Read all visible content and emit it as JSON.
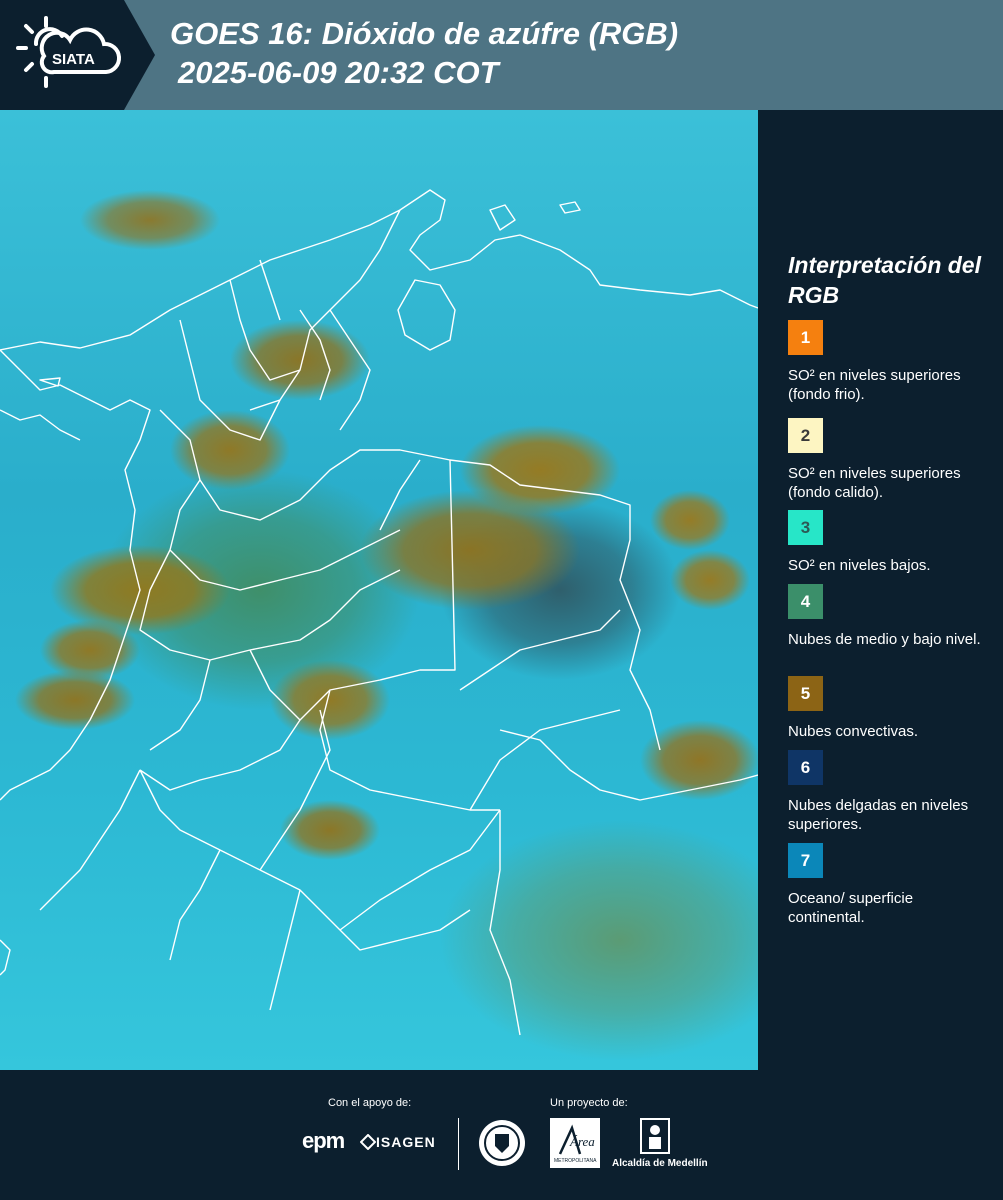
{
  "header": {
    "logo_text": "SIATA",
    "title_line1": "GOES 16: Dióxido de azúfre (RGB)",
    "title_line2": "2025-06-09 20:32 COT"
  },
  "legend": {
    "title": "Interpretación del RGB",
    "items": [
      {
        "number": "1",
        "color": "#f5800f",
        "text_color": "#ffffff",
        "text": "SO² en niveles superiores (fondo frio)."
      },
      {
        "number": "2",
        "color": "#fdf5c2",
        "text_color": "#3a3a3a",
        "text": "SO² en niveles superiores (fondo calido)."
      },
      {
        "number": "3",
        "color": "#27e6c8",
        "text_color": "#2c5a55",
        "text": "SO² en niveles bajos."
      },
      {
        "number": "4",
        "color": "#3b8f6a",
        "text_color": "#ffffff",
        "text": "Nubes de medio y bajo nivel."
      },
      {
        "number": "5",
        "color": "#8c6415",
        "text_color": "#ffffff",
        "text": "Nubes convectivas."
      },
      {
        "number": "6",
        "color": "#0f3566",
        "text_color": "#ffffff",
        "text": "Nubes delgadas en niveles superiores."
      },
      {
        "number": "7",
        "color": "#0b87b9",
        "text_color": "#ffffff",
        "text": "Oceano/ superficie continental."
      }
    ]
  },
  "footer": {
    "support_label": "Con el apoyo de:",
    "project_label": "Un proyecto de:",
    "epm": "epm",
    "isagen": "ISAGEN",
    "area_text": "Área",
    "area_subtext": "METROPOLITANA",
    "alcaldia": "Alcaldía de Medellín"
  }
}
